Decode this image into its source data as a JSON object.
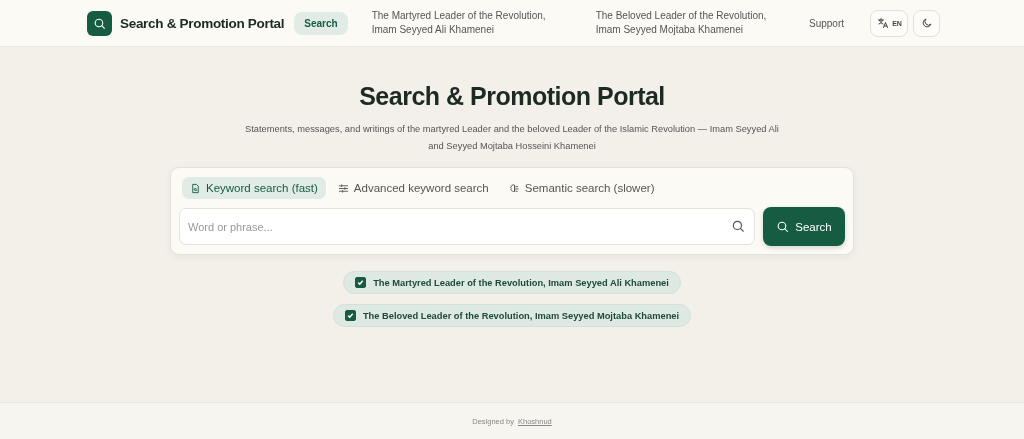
{
  "header": {
    "title": "Search & Promotion Portal",
    "nav": [
      {
        "label": "Search",
        "selected": true
      },
      {
        "label": "The Martyred Leader of the Revolution, Imam Seyyed Ali Khamenei",
        "selected": false
      },
      {
        "label": "The Beloved Leader of the Revolution, Imam Seyyed Mojtaba Khamenei",
        "selected": false
      },
      {
        "label": "Support",
        "selected": false
      }
    ],
    "language": "EN"
  },
  "hero": {
    "title": "Search & Promotion Portal",
    "subtitle": "Statements, messages, and writings of the martyred Leader and the beloved Leader of the Islamic Revolution — Imam Seyyed Ali and Seyyed Mojtaba Hosseini Khamenei"
  },
  "search": {
    "modes": [
      {
        "label": "Keyword search (fast)",
        "kind": "keyword",
        "selected": true
      },
      {
        "label": "Advanced keyword search",
        "kind": "advanced",
        "selected": false
      },
      {
        "label": "Semantic search (slower)",
        "kind": "semantic",
        "selected": false
      }
    ],
    "placeholder": "Word or phrase...",
    "button": "Search"
  },
  "sources": [
    {
      "label": "The Martyred Leader of the Revolution, Imam Seyyed Ali Khamenei",
      "checked": true
    },
    {
      "label": "The Beloved Leader of the Revolution, Imam Seyyed Mojtaba Khamenei",
      "checked": true
    }
  ],
  "footer": {
    "text": "Designed by",
    "link": "Khoshnud"
  }
}
